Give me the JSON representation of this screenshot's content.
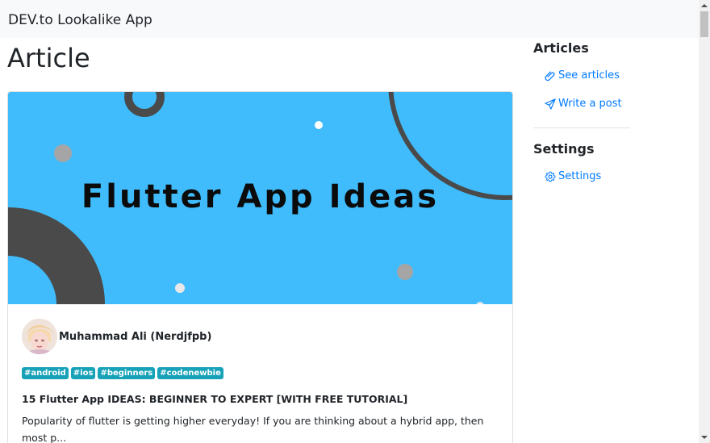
{
  "navbar": {
    "brand": "DEV.to Lookalike App"
  },
  "main": {
    "page_title": "Article",
    "card": {
      "cover_text": "Flutter App Ideas",
      "author": {
        "name": "Muhammad Ali (Nerdjfpb)"
      },
      "tags": [
        "#android",
        "#ios",
        "#beginners",
        "#codenewbie"
      ],
      "title": "15 Flutter App IDEAS: BEGINNER TO EXPERT [WITH FREE TUTORIAL]",
      "excerpt": "Popularity of flutter is getting higher everyday! If you are thinking about a hybrid app, then most p..."
    }
  },
  "sidebar": {
    "articles_heading": "Articles",
    "links": [
      {
        "label": "See articles",
        "icon": "paperclip-icon"
      },
      {
        "label": "Write a post",
        "icon": "paper-plane-icon"
      }
    ],
    "settings_heading": "Settings",
    "settings_link": {
      "label": "Settings",
      "icon": "gear-icon"
    }
  },
  "colors": {
    "navbar_bg": "#f8f9fa",
    "link": "#007bff",
    "tag_bg": "#17a2b8",
    "cover_bg": "#40bcfc"
  }
}
